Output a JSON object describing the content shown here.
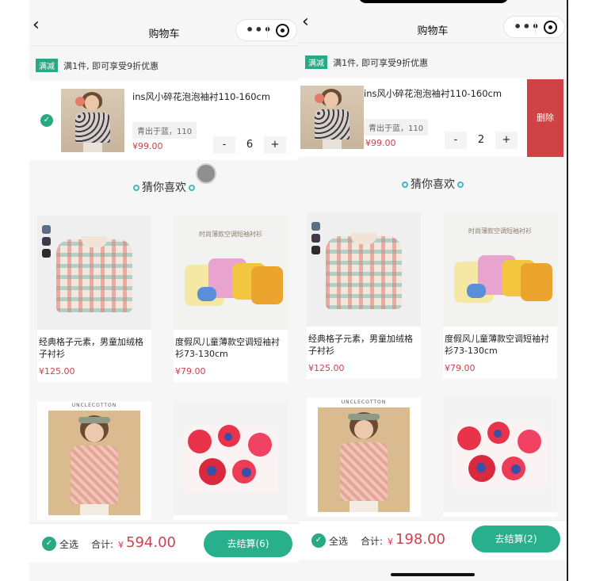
{
  "colors": {
    "accent": "#28a984",
    "price": "#d0404c",
    "delete": "#cf4346"
  },
  "nav": {
    "back_icon": "chevron-left-icon",
    "title": "购物车",
    "more_icon": "more-dots-icon",
    "close_icon": "target-icon"
  },
  "promo": {
    "tag": "满减",
    "text": "满1件, 即可享受9折优惠"
  },
  "cart_item": {
    "name": "ins风小碎花泡泡袖衬110-160cm",
    "sku": "青出于蓝，110",
    "price": "¥99.00"
  },
  "left": {
    "quantity": "6",
    "total": "594.00",
    "checkout": "去结算(6)"
  },
  "right": {
    "quantity": "2",
    "total": "198.00",
    "checkout": "去结算(2)",
    "delete": "删除"
  },
  "stepper": {
    "minus": "-",
    "plus": "+"
  },
  "guess": {
    "title": "猜你喜欢"
  },
  "products": [
    {
      "title": "经典格子元素，男童加绒格子衬衫",
      "price": "¥125.00"
    },
    {
      "title": "度假风儿童薄款空调短袖衬衫73-130cm",
      "price": "¥79.00"
    },
    {
      "brand": "UNCLECOTTON"
    },
    {
      "floral_heading": "时尚薄款空调短袖衬衫"
    }
  ],
  "bottom": {
    "select_all": "全选",
    "total_label": "合计:",
    "currency": "¥"
  }
}
